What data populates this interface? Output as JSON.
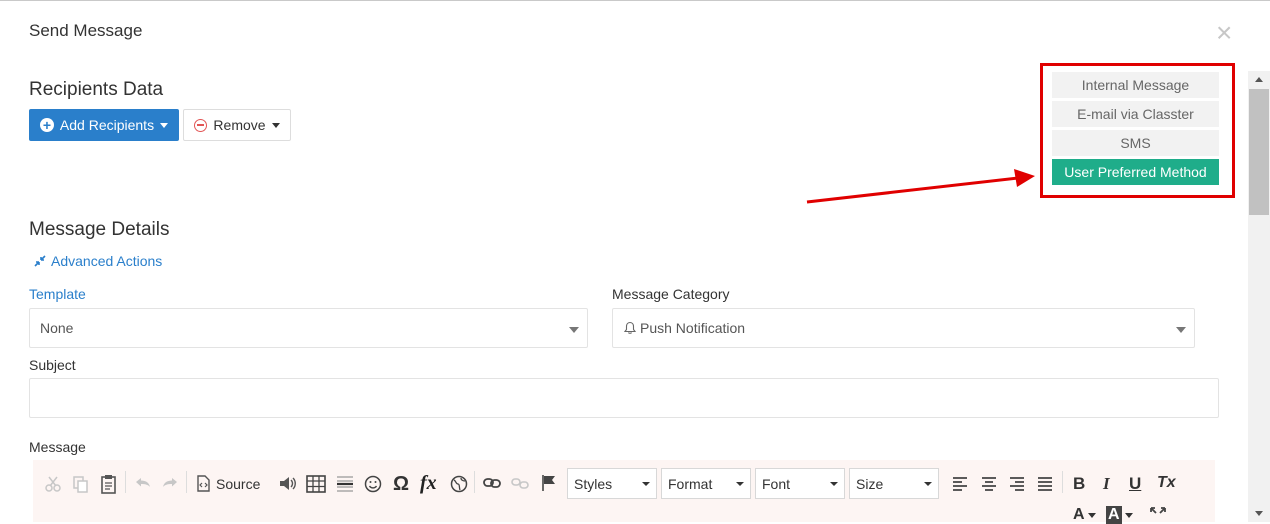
{
  "dialog": {
    "title": "Send Message"
  },
  "recipients": {
    "heading": "Recipients Data",
    "add_label": "Add Recipients",
    "remove_label": "Remove"
  },
  "methods": [
    {
      "label": "Internal Message",
      "active": false
    },
    {
      "label": "E-mail via Classter",
      "active": false
    },
    {
      "label": "SMS",
      "active": false
    },
    {
      "label": "User Preferred Method",
      "active": true
    }
  ],
  "details": {
    "heading": "Message Details",
    "advanced_actions": "Advanced Actions",
    "template_label": "Template",
    "template_value": "None",
    "category_label": "Message Category",
    "category_value": "Push Notification",
    "subject_label": "Subject",
    "subject_value": "",
    "message_label": "Message"
  },
  "editor": {
    "source_label": "Source",
    "styles_label": "Styles",
    "format_label": "Format",
    "font_label": "Font",
    "size_label": "Size",
    "bold": "B",
    "italic": "I",
    "underline": "U",
    "remove_format": "Tx",
    "text_color": "A",
    "bg_color": "A"
  },
  "colors": {
    "primary": "#2a7fcb",
    "active_method": "#1fad8a",
    "highlight_box": "#e00000"
  }
}
